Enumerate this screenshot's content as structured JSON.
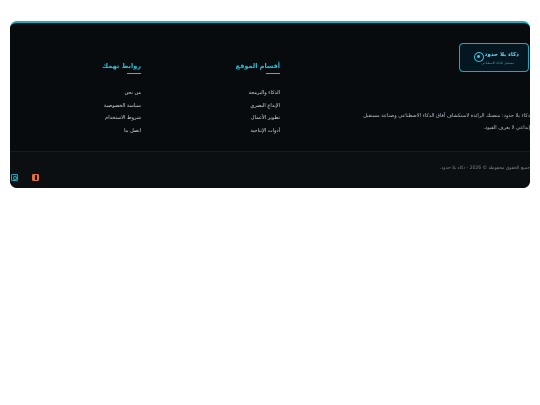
{
  "brand": {
    "logo_name": "ذكاء بلا حدود",
    "logo_tagline": "مستقبل الذكاء الاصطناعي",
    "description": "ذكاء بلا حدود: منصتك الرائدة لاستكشاف آفاق الذكاء الاصطناعي وصناعة مستقبل إبداعي لا يعرف القيود."
  },
  "quick_links": {
    "title": "روابط تهمك",
    "items": [
      {
        "label": "من نحن"
      },
      {
        "label": "سياسة الخصوصية"
      },
      {
        "label": "شروط الاستخدام"
      },
      {
        "label": "اتصل بنا"
      }
    ]
  },
  "site_sections": {
    "title": "أقسام الموقع",
    "items": [
      {
        "label": "الذكاء والبرمجة"
      },
      {
        "label": "الإبداع البصري"
      },
      {
        "label": "تطوير الأعمال"
      },
      {
        "label": "أدوات الإنتاجية"
      }
    ]
  },
  "bottom": {
    "copyright": "جميع الحقوق محفوظة © 2026 - ذكاء بلا حدود."
  },
  "social": [
    {
      "icon": "instagram-icon",
      "color": "#1ba3ba"
    },
    {
      "icon": "facebook-icon",
      "color": "#e86e3c"
    }
  ],
  "colors": {
    "accent": "#22c0dc",
    "background": "#080b0d"
  }
}
